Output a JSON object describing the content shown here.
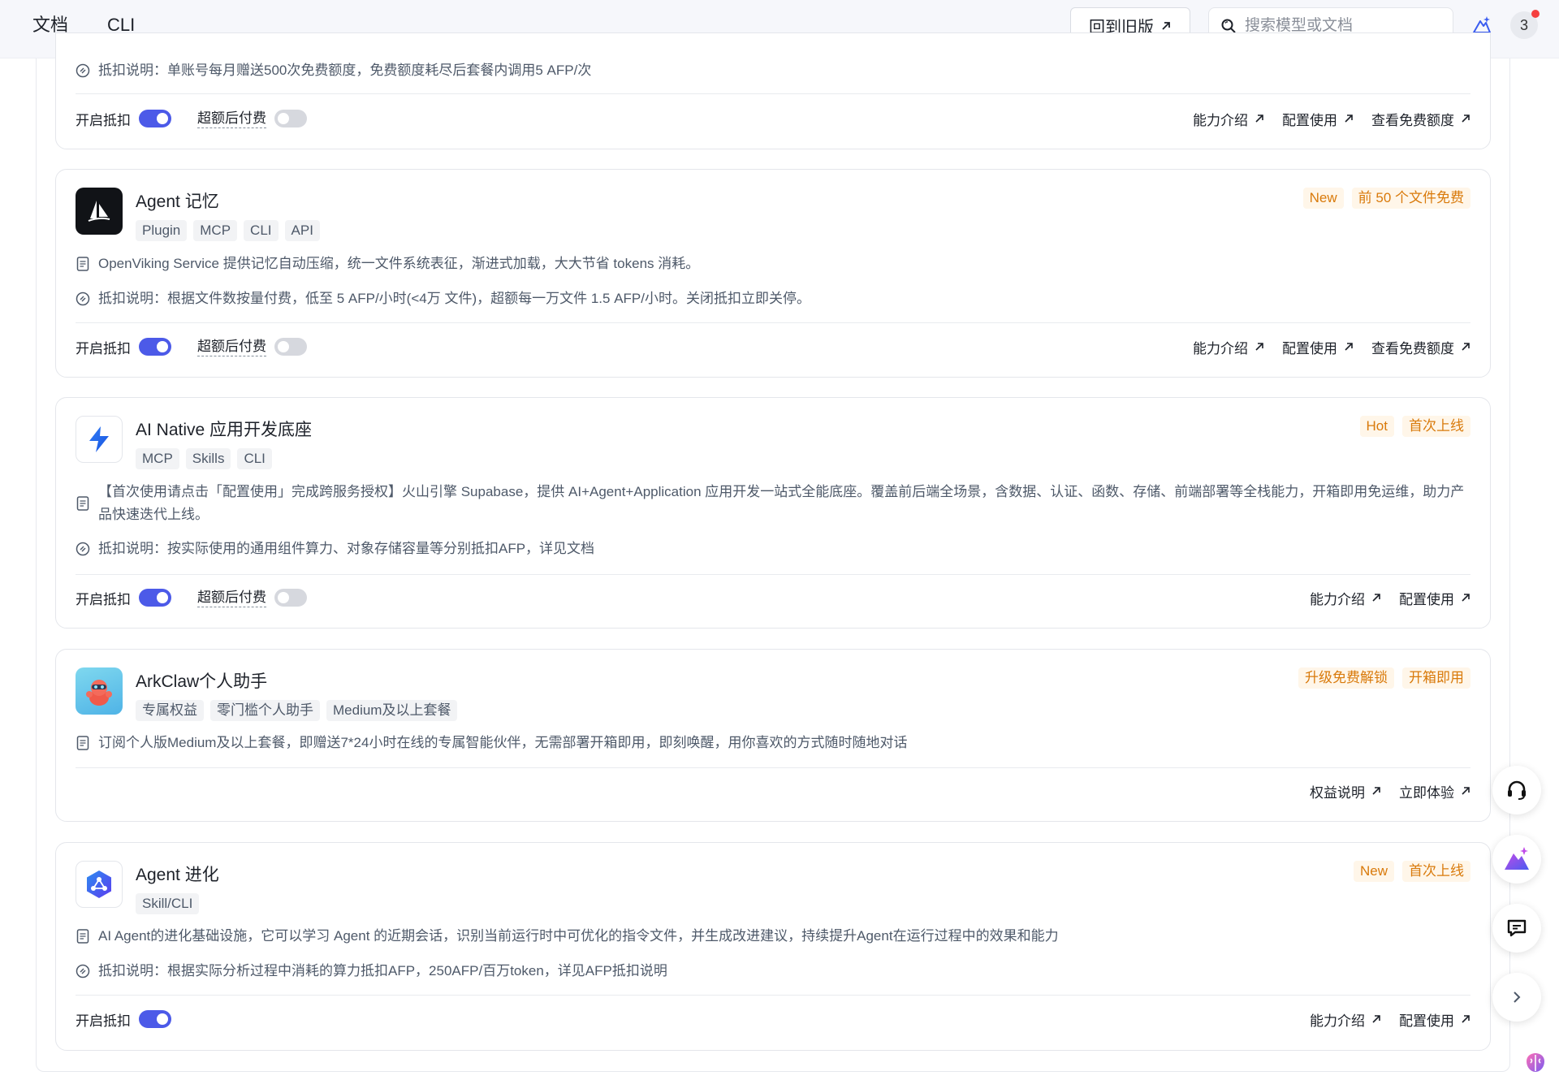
{
  "topbar": {
    "nav": [
      "文档",
      "CLI"
    ],
    "old_version": "回到旧版",
    "search_placeholder": "搜索模型或文档",
    "avatar": "3"
  },
  "labels": {
    "enable_deduct": "开启抵扣",
    "overage_pay": "超额后付费"
  },
  "cards": [
    {
      "deduct_note": "抵扣说明：单账号每月赠送500次免费额度，免费额度耗尽后套餐内调用5 AFP/次",
      "links": [
        "能力介绍",
        "配置使用",
        "查看免费额度"
      ]
    },
    {
      "title": "Agent 记忆",
      "tags": [
        "Plugin",
        "MCP",
        "CLI",
        "API"
      ],
      "badges": [
        "New",
        "前 50 个文件免费"
      ],
      "desc": "OpenViking Service 提供记忆自动压缩，统一文件系统表征，渐进式加载，大大节省 tokens 消耗。",
      "deduct_note": "抵扣说明：根据文件数按量付费，低至 5 AFP/小时(<4万 文件)，超额每一万文件 1.5 AFP/小时。关闭抵扣立即关停。",
      "links": [
        "能力介绍",
        "配置使用",
        "查看免费额度"
      ]
    },
    {
      "title": "AI Native 应用开发底座",
      "tags": [
        "MCP",
        "Skills",
        "CLI"
      ],
      "badges": [
        "Hot",
        "首次上线"
      ],
      "desc": "【首次使用请点击「配置使用」完成跨服务授权】火山引擎 Supabase，提供 AI+Agent+Application 应用开发一站式全能底座。覆盖前后端全场景，含数据、认证、函数、存储、前端部署等全栈能力，开箱即用免运维，助力产品快速迭代上线。",
      "deduct_note": "抵扣说明：按实际使用的通用组件算力、对象存储容量等分别抵扣AFP，详见文档",
      "links": [
        "能力介绍",
        "配置使用"
      ]
    },
    {
      "title": "ArkClaw个人助手",
      "tags": [
        "专属权益",
        "零门槛个人助手",
        "Medium及以上套餐"
      ],
      "badges": [
        "升级免费解锁",
        "开箱即用"
      ],
      "desc": "订阅个人版Medium及以上套餐，即赠送7*24小时在线的专属智能伙伴，无需部署开箱即用，即刻唤醒，用你喜欢的方式随时随地对话",
      "links": [
        "权益说明",
        "立即体验"
      ]
    },
    {
      "title": "Agent 进化",
      "tags": [
        "Skill/CLI"
      ],
      "badges": [
        "New",
        "首次上线"
      ],
      "desc": "AI Agent的进化基础设施，它可以学习 Agent 的近期会话，识别当前运行时中可优化的指令文件，并生成改进建议，持续提升Agent在运行过程中的效果和能力",
      "deduct_note": "抵扣说明：根据实际分析过程中消耗的算力抵扣AFP，250AFP/百万token，详见AFP抵扣说明",
      "links": [
        "能力介绍",
        "配置使用"
      ]
    }
  ],
  "colors": {
    "toggle_on": "#4c5ae8",
    "toggle_off": "#d6d8de",
    "badge_text": "#d97a0b",
    "badge_bg": "#fff6e9"
  }
}
